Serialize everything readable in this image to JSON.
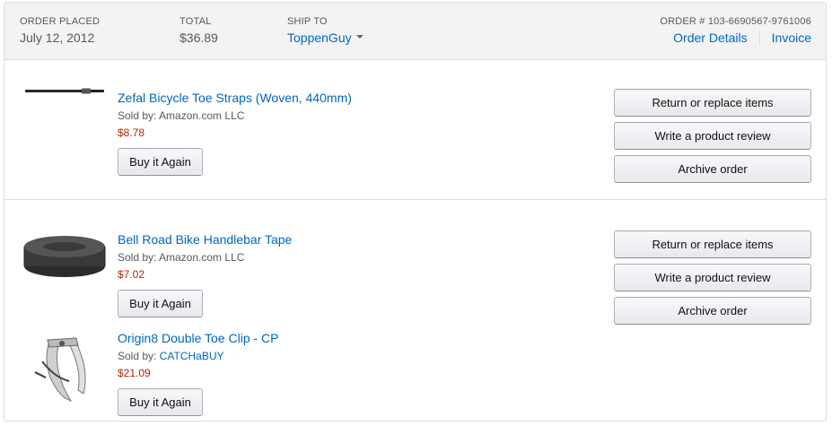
{
  "order": {
    "placed_label": "ORDER PLACED",
    "placed_value": "July 12, 2012",
    "total_label": "TOTAL",
    "total_value": "$36.89",
    "shipto_label": "SHIP TO",
    "shipto_value": "ToppenGuy",
    "number_label": "ORDER # 103-6690567-9761006",
    "details_link": "Order Details",
    "invoice_link": "Invoice"
  },
  "shipments": [
    {
      "items": [
        {
          "title": "Zefal Bicycle Toe Straps (Woven, 440mm)",
          "seller_prefix": "Sold by: ",
          "seller": "Amazon.com LLC",
          "price": "$8.78",
          "buy_again": "Buy it Again",
          "image_icon": "toe-strap-image"
        }
      ],
      "actions": [
        "Return or replace items",
        "Write a product review",
        "Archive order"
      ]
    },
    {
      "items": [
        {
          "title": "Bell Road Bike Handlebar Tape",
          "seller_prefix": "Sold by: ",
          "seller": "Amazon.com LLC",
          "price": "$7.02",
          "buy_again": "Buy it Again",
          "image_icon": "handlebar-tape-image"
        },
        {
          "title": "Origin8 Double Toe Clip - CP",
          "seller_prefix": "Sold by: ",
          "seller": "CATCHaBUY",
          "price": "$21.09",
          "buy_again": "Buy it Again",
          "image_icon": "toe-clip-image"
        }
      ],
      "actions": [
        "Return or replace items",
        "Write a product review",
        "Archive order"
      ]
    }
  ],
  "colors": {
    "link": "#0066c0",
    "price": "#b12704",
    "header_bg": "#f3f3f3"
  }
}
